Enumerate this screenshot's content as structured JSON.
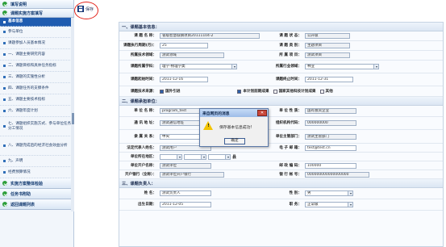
{
  "sidebar": {
    "groups": [
      {
        "label": "填写说明"
      },
      {
        "label": "课题实施方案填写"
      },
      {
        "label": "实施方案整体检验"
      },
      {
        "label": "任务书附助"
      },
      {
        "label": "返回课题列表"
      }
    ],
    "items": [
      {
        "label": "基本信息"
      },
      {
        "label": "参与单位"
      },
      {
        "label": "课题参加人员基本情况"
      },
      {
        "label": "一、课题主要研究内容"
      },
      {
        "label": "二、课题目标和具体任务指标"
      },
      {
        "label": "三、课题的实施性分析"
      },
      {
        "label": "四、课题任务的支撑条件"
      },
      {
        "label": "五、课题主要技术指标"
      },
      {
        "label": "六、课题年度计划"
      },
      {
        "label": "七、课题组织实施方式、参与单位任务分工情况"
      },
      {
        "label": "八、课题完成后的经济社会效益分析"
      },
      {
        "label": "九、声明"
      },
      {
        "label": "经费预算情况"
      }
    ]
  },
  "toolbar": {
    "save_label": "保存"
  },
  "sections": {
    "basic": "一、课题基本信息：",
    "unit": "二、课题承担单位：",
    "leader": "三、课题负责人："
  },
  "basic": {
    "name_label": "课 题 名 称：",
    "name_value": "省级智慧城镇项目20111104-2",
    "status_label": "课 题 状 态：",
    "status_value": "公开级",
    "period_label": "课题执行周期(月)：",
    "period_value": "25",
    "type_label": "课 题 类 别：",
    "type_value": "主题项目",
    "field_label": "所属技术领域：",
    "field_value": "测试领域",
    "project_label": "所 属 项 目：",
    "project_value": "测试项目",
    "discipline_label": "课题所属学科：",
    "discipline_value": "理学-物理学类",
    "industry_label": "所属行业领域：",
    "industry_value": "林业",
    "start_label": "课题起始时间：",
    "start_value": "2011-12-16",
    "end_label": "课题终止时间：",
    "end_value": "2011-12-31",
    "tech_label": "课题技术来源：",
    "tech_options": [
      {
        "label": "国外引进",
        "checked": true
      },
      {
        "label": "本计划前期成果",
        "checked": true
      },
      {
        "label": "国家其他科技计划成果",
        "checked": false
      },
      {
        "label": "其他",
        "checked": false
      }
    ]
  },
  "unit": {
    "name_label": "单 位 名 称：",
    "name_value": "program_test",
    "nature_label": "单 位 性 质：",
    "nature_value": "国有独资企业",
    "addr_label": "通 讯 地 址：",
    "addr_value": "测试通信地址",
    "org_code_label": "组织机构代码：",
    "org_code_value": "000000000",
    "category_label": "隶 属 关 系：",
    "category_value": "中央",
    "dept_label": "单位主管部门：",
    "dept_value": "测试主管部门",
    "legal_label": "法定代表人姓名：",
    "legal_value": "测试用户",
    "email_label": "电 子 邮 箱：",
    "email_value": "test@test.cn",
    "region_label": "单位所在地区：",
    "region_county": "县",
    "bank_label": "单位开户名称：",
    "bank_value": "测试单位",
    "post_label": "邮 政 编 码：",
    "post_value": "100000",
    "bank_branch_label": "开户银行（全称）：",
    "bank_branch_value": "测试单位开户银行",
    "account_label": "银 行 帐 号：",
    "account_value": "000000000000000000"
  },
  "leader": {
    "name_label": "姓 名：",
    "name_value": "测试负责人",
    "sex_label": "性 别：",
    "sex_value": "男",
    "birth_label": "出生日期：",
    "birth_value": "2011-12-05",
    "title_label": "职 务：",
    "title_value": "正常级"
  },
  "dialog": {
    "title": "来自网页的消息",
    "message": "保存基本信息成功!",
    "ok_label": "确定",
    "close_glyph": "✕",
    "icon_mark": "!"
  },
  "colors": {
    "accent": "#1f5cb0",
    "highlight": "#e3231b",
    "group_icon": "#2c9e3a",
    "dialog_warning": "#f3c400"
  }
}
